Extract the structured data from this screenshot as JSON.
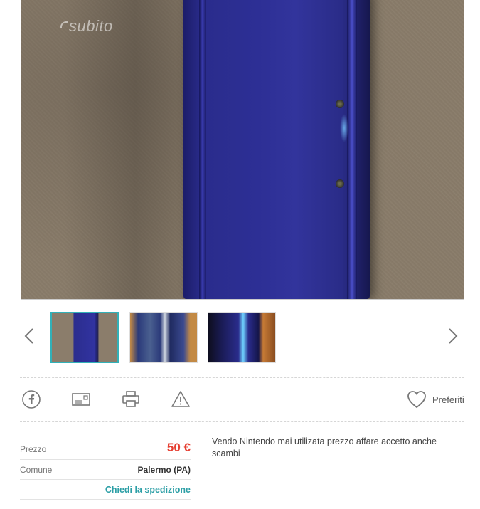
{
  "gallery": {
    "watermark": "subito",
    "prev_icon": "chevron-left-icon",
    "next_icon": "chevron-right-icon",
    "selected_index": 0,
    "thumbnail_count": 3,
    "active_border_color": "#32b1b8"
  },
  "actions": {
    "icons": [
      "facebook-icon",
      "mail-icon",
      "print-icon",
      "warning-icon"
    ],
    "favorites_label": "Preferiti",
    "favorites_icon": "heart-icon"
  },
  "details": {
    "price_label": "Prezzo",
    "price_value": "50 €",
    "price_color": "#e63f32",
    "comune_label": "Comune",
    "comune_value": "Palermo (PA)",
    "shipping_link": "Chiedi la spedizione",
    "link_color": "#2c9fa6"
  },
  "description": "Vendo Nintendo mai utilizata prezzo affare accetto anche scambi"
}
